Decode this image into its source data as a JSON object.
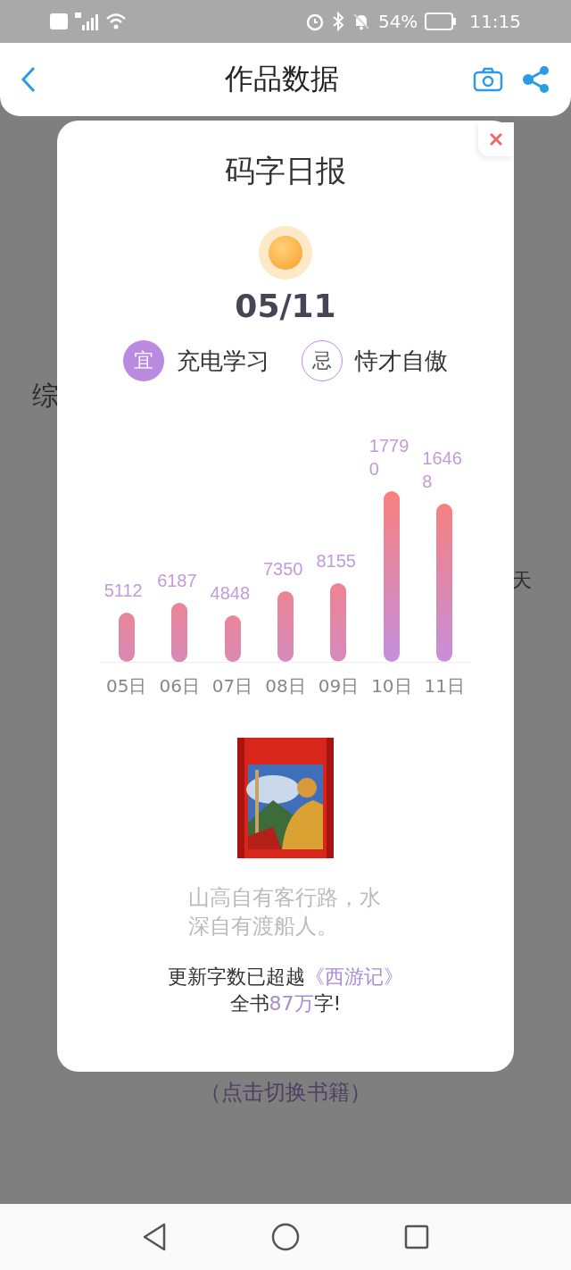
{
  "status_bar": {
    "battery": "54%",
    "time": "11:15"
  },
  "header": {
    "title": "作品数据"
  },
  "background": {
    "section_label": "综",
    "side_label": "天",
    "switch_hint": "（点击切换书籍）"
  },
  "dialog": {
    "title": "码字日报",
    "date": "05/11",
    "tags": [
      {
        "kind": "good",
        "badge": "宜",
        "text": "充电学习"
      },
      {
        "kind": "bad",
        "badge": "忌",
        "text": "恃才自傲"
      }
    ],
    "chart_data": {
      "type": "bar",
      "categories": [
        "05日",
        "06日",
        "07日",
        "08日",
        "09日",
        "10日",
        "11日"
      ],
      "values": [
        5112,
        6187,
        4848,
        7350,
        8155,
        17790,
        16468
      ],
      "data_labels": true
    },
    "quote": "山高自有客行路，水深自有渡船人。",
    "summary": {
      "lines": [
        [
          {
            "text": "更新字数已超越",
            "highlight": false
          },
          {
            "text": "《西游记》",
            "highlight": true
          }
        ],
        [
          {
            "text": "全书",
            "highlight": false
          },
          {
            "text": "87万",
            "highlight": true
          },
          {
            "text": "字!",
            "highlight": false
          }
        ]
      ]
    }
  }
}
